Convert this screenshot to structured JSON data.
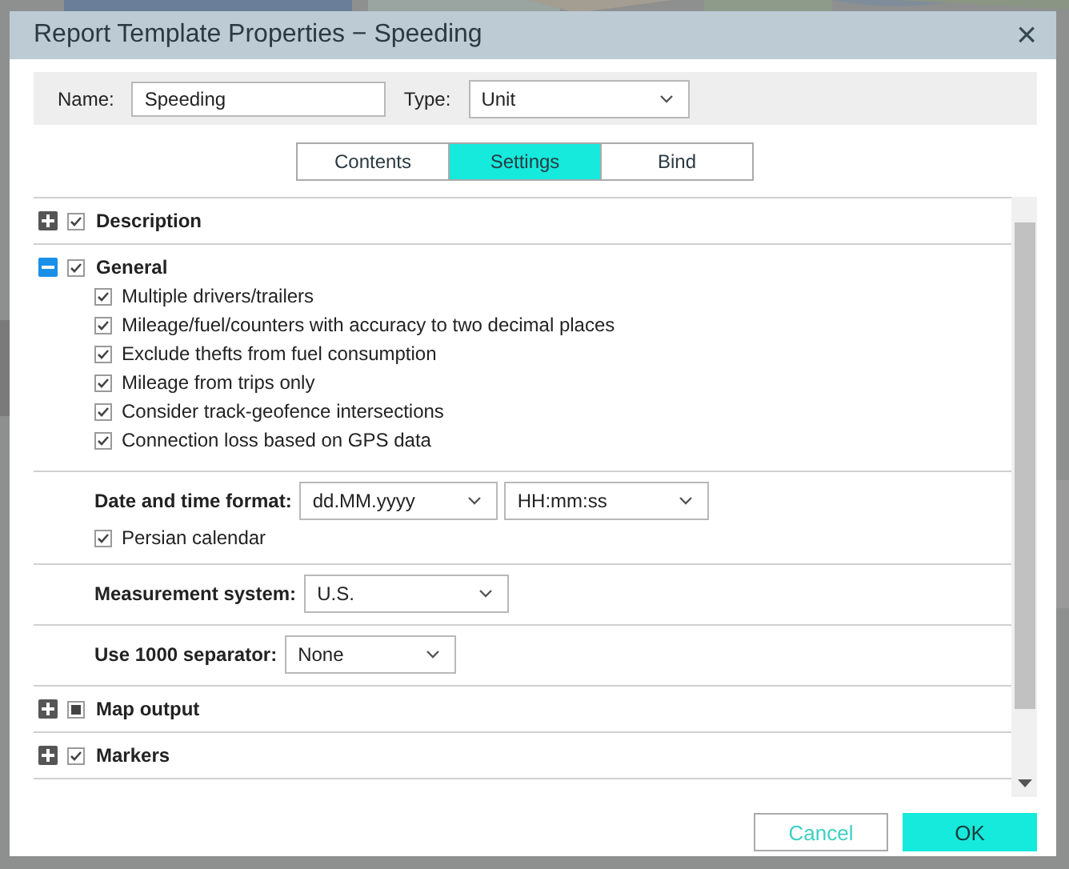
{
  "window": {
    "title": "Report Template Properties − Speeding",
    "close": "×"
  },
  "name_field": {
    "label": "Name:",
    "value": "Speeding"
  },
  "type_field": {
    "label": "Type:",
    "value": "Unit"
  },
  "tabs": [
    {
      "label": "Contents",
      "selected": false
    },
    {
      "label": "Settings",
      "selected": true
    },
    {
      "label": "Bind",
      "selected": false
    }
  ],
  "sections": [
    {
      "title": "Description",
      "expanded": false,
      "checked": true,
      "partial": false
    },
    {
      "title": "General",
      "expanded": true,
      "checked": true,
      "partial": false,
      "groups": [
        {
          "kind": "checks",
          "items": [
            {
              "label": "Multiple drivers/trailers",
              "checked": true
            },
            {
              "label": "Mileage/fuel/counters with accuracy to two decimal places",
              "checked": true
            },
            {
              "label": "Exclude thefts from fuel consumption",
              "checked": true
            },
            {
              "label": "Mileage from trips only",
              "checked": true
            },
            {
              "label": "Consider track-geofence intersections",
              "checked": true
            },
            {
              "label": "Connection loss based on GPS data",
              "checked": true
            }
          ]
        },
        {
          "kind": "select",
          "label": "Date and time format:",
          "selects": [
            "dd.MM.yyyy",
            "HH:mm:ss"
          ],
          "items": [
            {
              "label": "Persian calendar",
              "checked": true
            }
          ]
        },
        {
          "kind": "select",
          "label": "Measurement system:",
          "selects": [
            "U.S."
          ]
        },
        {
          "kind": "select",
          "label": "Use 1000 separator:",
          "selects": [
            "None"
          ]
        }
      ]
    },
    {
      "title": "Map output",
      "expanded": false,
      "partial": true
    },
    {
      "title": "Markers",
      "expanded": false,
      "checked": true,
      "partial": false
    }
  ],
  "buttons": [
    {
      "label": "Cancel",
      "kind": "secondary"
    },
    {
      "label": "OK",
      "kind": "primary"
    }
  ]
}
